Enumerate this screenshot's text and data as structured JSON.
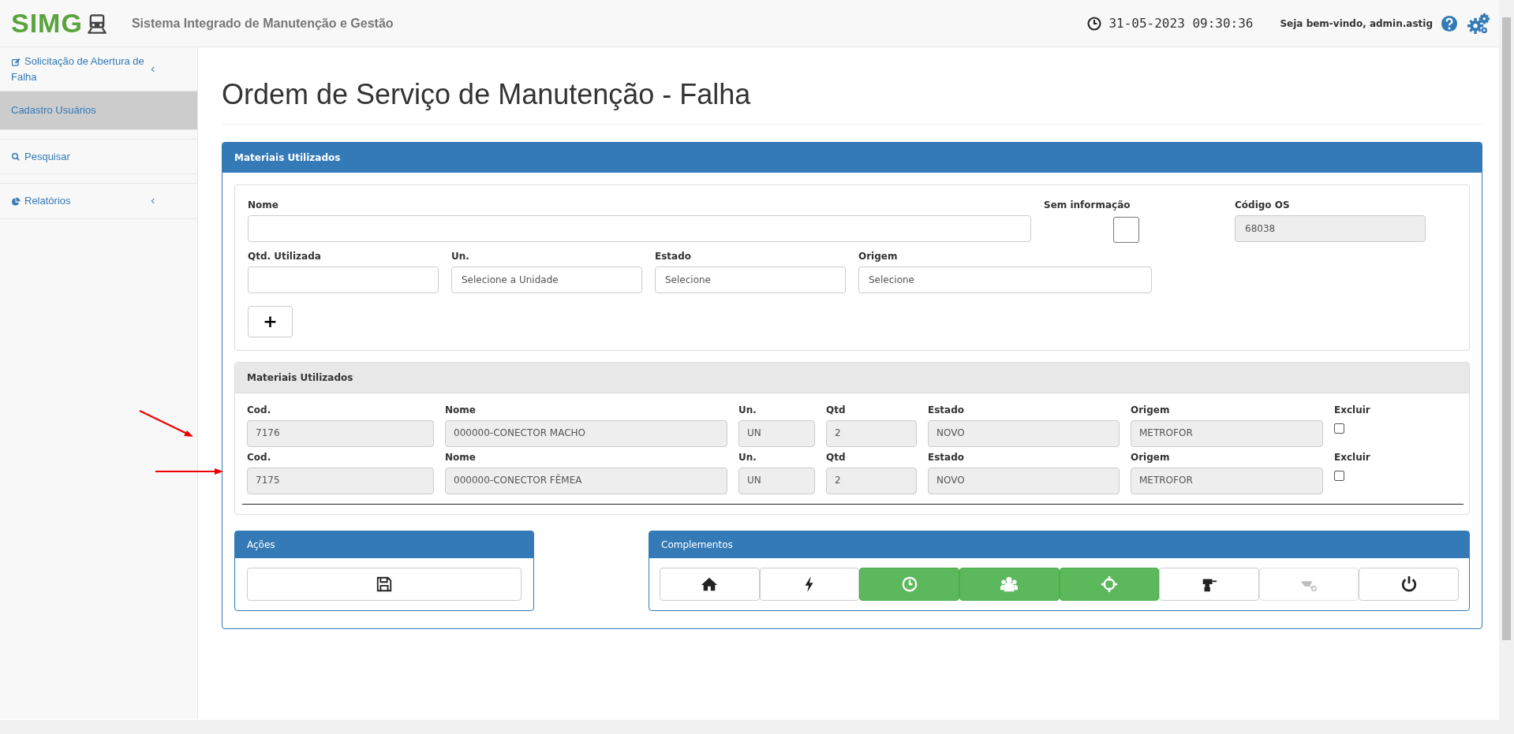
{
  "header": {
    "logo": "SIMG",
    "system_title": "Sistema Integrado de Manutenção e Gestão",
    "datetime": "31-05-2023 09:30:36",
    "welcome": "Seja bem-vindo, admin.astig"
  },
  "sidebar": {
    "items": [
      {
        "label": "Solicitação de Abertura de Falha",
        "kind": "edit",
        "has_submenu": true,
        "selected": false
      },
      {
        "label": "Cadastro Usuários",
        "kind": "plain",
        "has_submenu": false,
        "selected": true
      },
      {
        "label": "Pesquisar",
        "kind": "search",
        "has_submenu": false,
        "selected": false
      },
      {
        "label": "Relatórios",
        "kind": "chart",
        "has_submenu": true,
        "selected": false
      }
    ]
  },
  "page_title": "Ordem de Serviço de Manutenção - Falha",
  "panel": {
    "title": "Materiais Utilizados",
    "form": {
      "rows": [
        [
          {
            "label": "Nome",
            "kind": "text",
            "readonly": false
          },
          {
            "label": "Sem informação",
            "kind": "checkbox",
            "checked": false
          },
          {
            "label": "Código OS",
            "kind": "text",
            "value": "68038",
            "readonly": true
          }
        ],
        [
          {
            "label": "Qtd. Utilizada",
            "kind": "text",
            "readonly": false
          },
          {
            "label": "Un.",
            "kind": "select",
            "value": "Selecione a Unidade"
          },
          {
            "label": "Estado",
            "kind": "select",
            "value": "Selecione"
          },
          {
            "label": "Origem",
            "kind": "select",
            "value": "Selecione"
          }
        ]
      ],
      "add_button": "+"
    },
    "materials": {
      "title": "Materiais Utilizados",
      "rows": [
        {
          "marked": true,
          "cells": [
            {
              "label": "Cod.",
              "value": "7176"
            },
            {
              "label": "Nome",
              "value": "000000-CONECTOR MACHO"
            },
            {
              "label": "Un.",
              "value": "UN"
            },
            {
              "label": "Qtd",
              "value": "2"
            },
            {
              "label": "Estado",
              "value": "NOVO"
            },
            {
              "label": "Origem",
              "value": "METROFOR"
            }
          ],
          "delete_label": "Excluir",
          "checked": false
        },
        {
          "marked": true,
          "cells": [
            {
              "label": "Cod.",
              "value": "7175"
            },
            {
              "label": "Nome",
              "value": "000000-CONECTOR FÊMEA"
            },
            {
              "label": "Un.",
              "value": "UN"
            },
            {
              "label": "Qtd",
              "value": "2"
            },
            {
              "label": "Estado",
              "value": "NOVO"
            },
            {
              "label": "Origem",
              "value": "METROFOR"
            }
          ],
          "delete_label": "Excluir",
          "checked": false
        }
      ]
    },
    "actions": {
      "title": "Ações"
    },
    "complements": {
      "title": "Complementos",
      "buttons": [
        {
          "kind": "home",
          "active": false,
          "disabled": false
        },
        {
          "kind": "bolt",
          "active": false,
          "disabled": false
        },
        {
          "kind": "clock",
          "active": true,
          "disabled": false
        },
        {
          "kind": "users",
          "active": true,
          "disabled": false
        },
        {
          "kind": "target",
          "active": true,
          "disabled": false
        },
        {
          "kind": "drill",
          "active": false,
          "disabled": false
        },
        {
          "kind": "wheelbarrow",
          "active": false,
          "disabled": true
        },
        {
          "kind": "power",
          "active": false,
          "disabled": false
        }
      ]
    }
  }
}
